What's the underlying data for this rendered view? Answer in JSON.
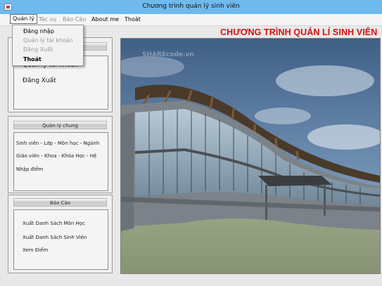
{
  "window": {
    "title": "Chương trình quản lý sinh viên"
  },
  "menu": [
    {
      "label": "Quản lý",
      "state": "active"
    },
    {
      "label": "Tác vụ",
      "state": "disabled"
    },
    {
      "label": "Báo Cáo",
      "state": "disabled"
    },
    {
      "label": "About me",
      "state": "enabled"
    },
    {
      "label": "Thoát",
      "state": "enabled"
    }
  ],
  "dropdown": {
    "items": [
      {
        "label": "Đăng nhập",
        "enabled": true
      },
      {
        "label": "Quản lý tài khoản",
        "enabled": false
      },
      {
        "label": "Đăng Xuất",
        "enabled": false
      },
      {
        "label": "Thoát",
        "enabled": true
      }
    ]
  },
  "account_panel": {
    "items": [
      "Quản lý tài khoản",
      "Đăng Xuất"
    ]
  },
  "general_panel": {
    "header": "Quản lý chung",
    "items": [
      "Sinh viên - Lớp - Môn học - Ngành",
      "Giáo viên - Khoa - Khóa Học - Hệ",
      "Nhập điểm"
    ]
  },
  "report_panel": {
    "header": "Báo Cáo",
    "items": [
      "Xuất Danh Sách Môn Học",
      "Xuất Danh Sách Sinh Viên",
      "Xem Điểm"
    ]
  },
  "banner": {
    "title": "CHƯƠNG TRÌNH QUẢN LÍ SINH VIÊN"
  },
  "watermark": {
    "text": "SHAREcode.vn"
  },
  "colors": {
    "titlebar": "#6fb9ec",
    "banner_title": "#d61010",
    "panel_bg": "#f0f0f0"
  }
}
